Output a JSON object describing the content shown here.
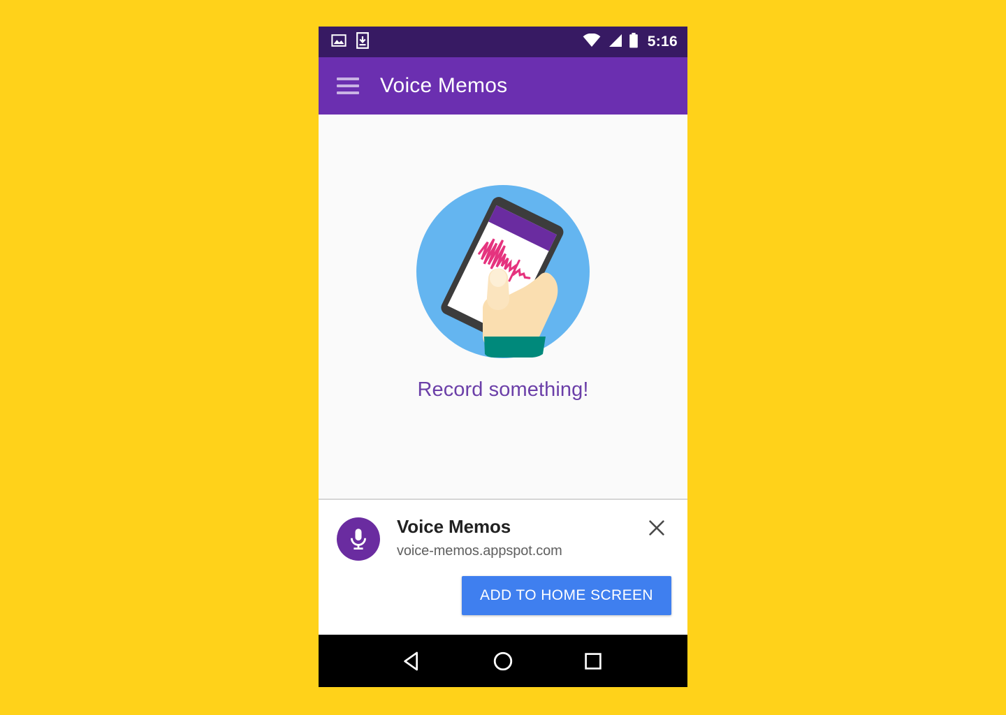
{
  "page": {
    "background_color": "#FFD21A"
  },
  "status_bar": {
    "background_color": "#371A63",
    "time": "5:16",
    "left_icons": [
      "image-icon",
      "download-to-device-icon"
    ],
    "right_icons": [
      "wifi-icon",
      "cellular-signal-icon",
      "battery-icon"
    ]
  },
  "toolbar": {
    "background_color": "#6B2FB0",
    "menu_icon": "hamburger-menu-icon",
    "title": "Voice Memos"
  },
  "content": {
    "background_color": "#FAFAFA",
    "illustration": "hand-holding-phone-with-waveform-illustration",
    "illustration_colors": {
      "circle": "#64B5F0",
      "phone_body": "#3C3C3C",
      "phone_screen": "#FFFFFF",
      "phone_header": "#6A2CA0",
      "waveform": "#E5337E",
      "skin": "#FADEB0",
      "sleeve": "#00897B"
    },
    "empty_message": "Record something!",
    "empty_message_color": "#6B3FA8"
  },
  "install_banner": {
    "background_color": "#FFFFFF",
    "app_icon": "microphone-icon",
    "app_icon_color": "#6A2CA0",
    "app_name": "Voice Memos",
    "app_url": "voice-memos.appspot.com",
    "close_icon": "close-icon",
    "add_button_label": "ADD TO HOME SCREEN",
    "add_button_color": "#3F7FEF"
  },
  "nav_bar": {
    "background_color": "#000000",
    "buttons": [
      {
        "name": "back",
        "icon": "back-triangle-icon"
      },
      {
        "name": "home",
        "icon": "home-circle-icon"
      },
      {
        "name": "recents",
        "icon": "recents-square-icon"
      }
    ]
  }
}
